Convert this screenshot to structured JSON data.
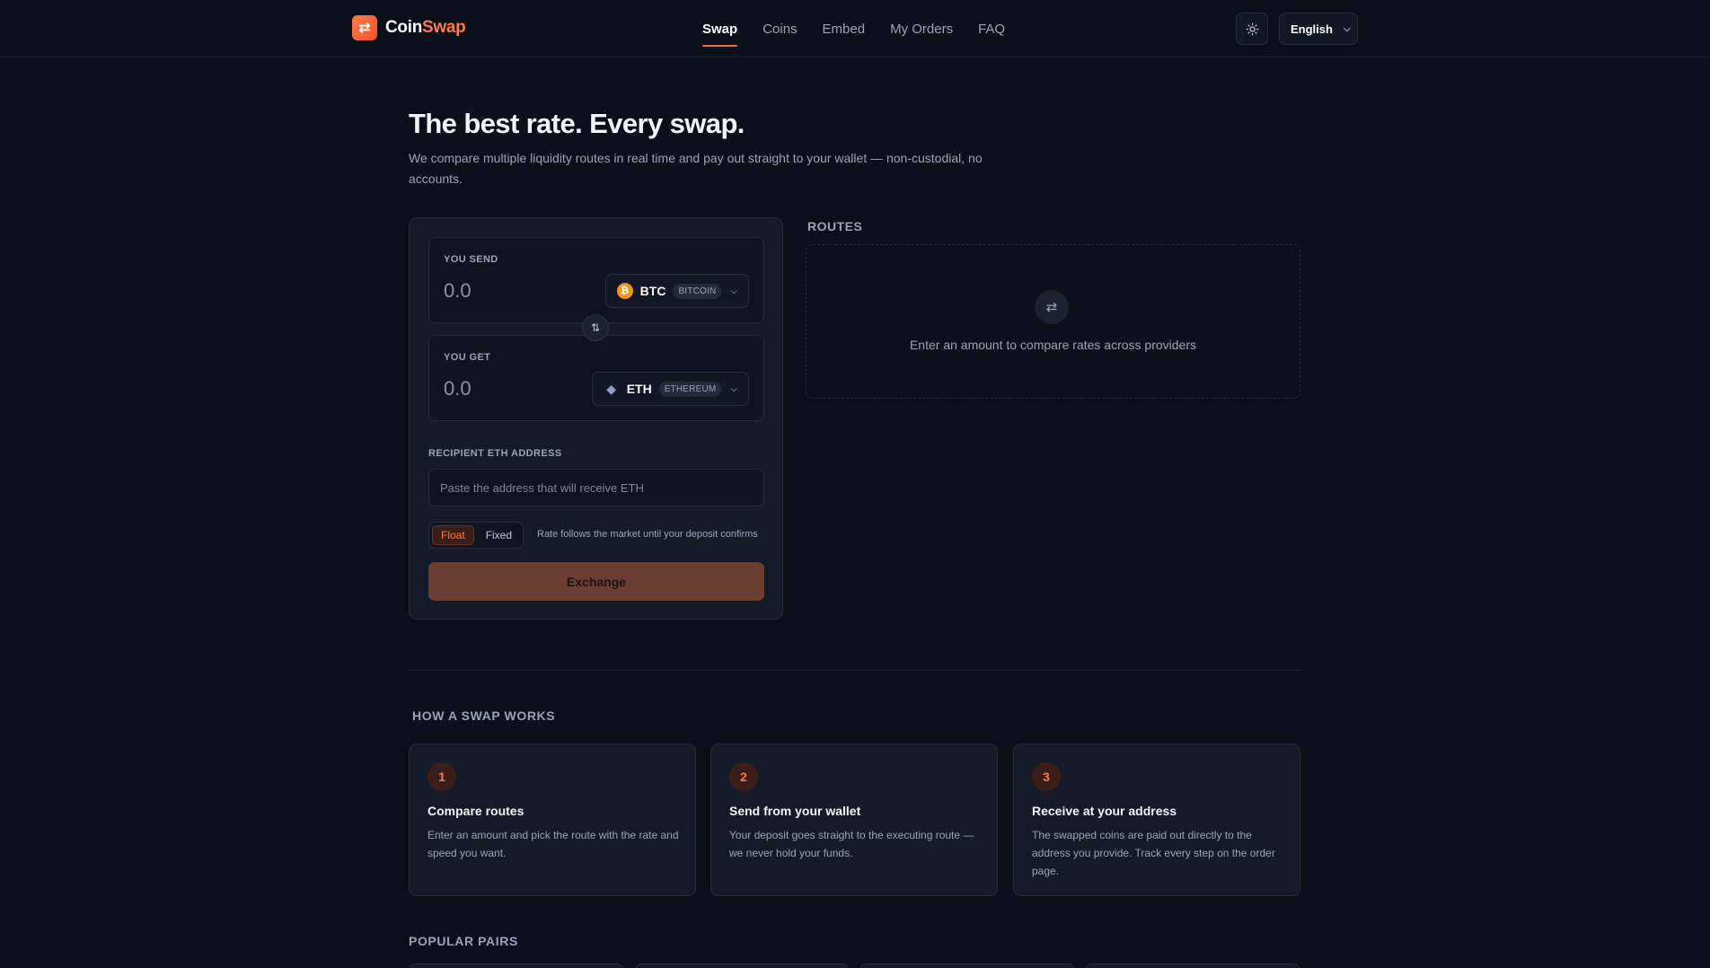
{
  "brand": {
    "part1": "Coin",
    "part2": "Swap"
  },
  "nav": [
    {
      "label": "Swap",
      "active": true
    },
    {
      "label": "Coins",
      "active": false
    },
    {
      "label": "Embed",
      "active": false
    },
    {
      "label": "My Orders",
      "active": false
    },
    {
      "label": "FAQ",
      "active": false
    }
  ],
  "language": "English",
  "hero": {
    "title": "The best rate. Every swap.",
    "subtitle": "We compare multiple liquidity routes in real time and pay out straight to your wallet — non-custodial, no accounts."
  },
  "swap": {
    "send": {
      "label": "YOU SEND",
      "amount": "0.0",
      "ticker": "BTC",
      "network": "BITCOIN"
    },
    "get": {
      "label": "YOU GET",
      "amount": "0.0",
      "ticker": "ETH",
      "network": "ETHEREUM"
    },
    "recipient_label": "RECIPIENT ETH ADDRESS",
    "recipient_placeholder": "Paste the address that will receive ETH",
    "rate_types": {
      "float": "Float",
      "fixed": "Fixed",
      "selected": "Float"
    },
    "rate_note": "Rate follows the market until your deposit confirms",
    "exchange_label": "Exchange"
  },
  "routes": {
    "title": "ROUTES",
    "empty_text": "Enter an amount to compare rates across providers"
  },
  "how": {
    "title": "HOW A SWAP WORKS",
    "steps": [
      {
        "num": "1",
        "title": "Compare routes",
        "desc": "Enter an amount and pick the route with the rate and speed you want."
      },
      {
        "num": "2",
        "title": "Send from your wallet",
        "desc": "Your deposit goes straight to the executing route — we never hold your funds."
      },
      {
        "num": "3",
        "title": "Receive at your address",
        "desc": "The swapped coins are paid out directly to the address you provide. Track every step on the order page."
      }
    ]
  },
  "pairs": {
    "title": "POPULAR PAIRS"
  },
  "colors": {
    "accent": "#ff6a3a",
    "background": "#0b0f1a",
    "card": "#151a28"
  },
  "icons": {
    "logo": "swap-arrows-icon",
    "theme": "sun-icon",
    "flip": "flip-arrows-icon",
    "routes": "swap-arrows-icon"
  }
}
